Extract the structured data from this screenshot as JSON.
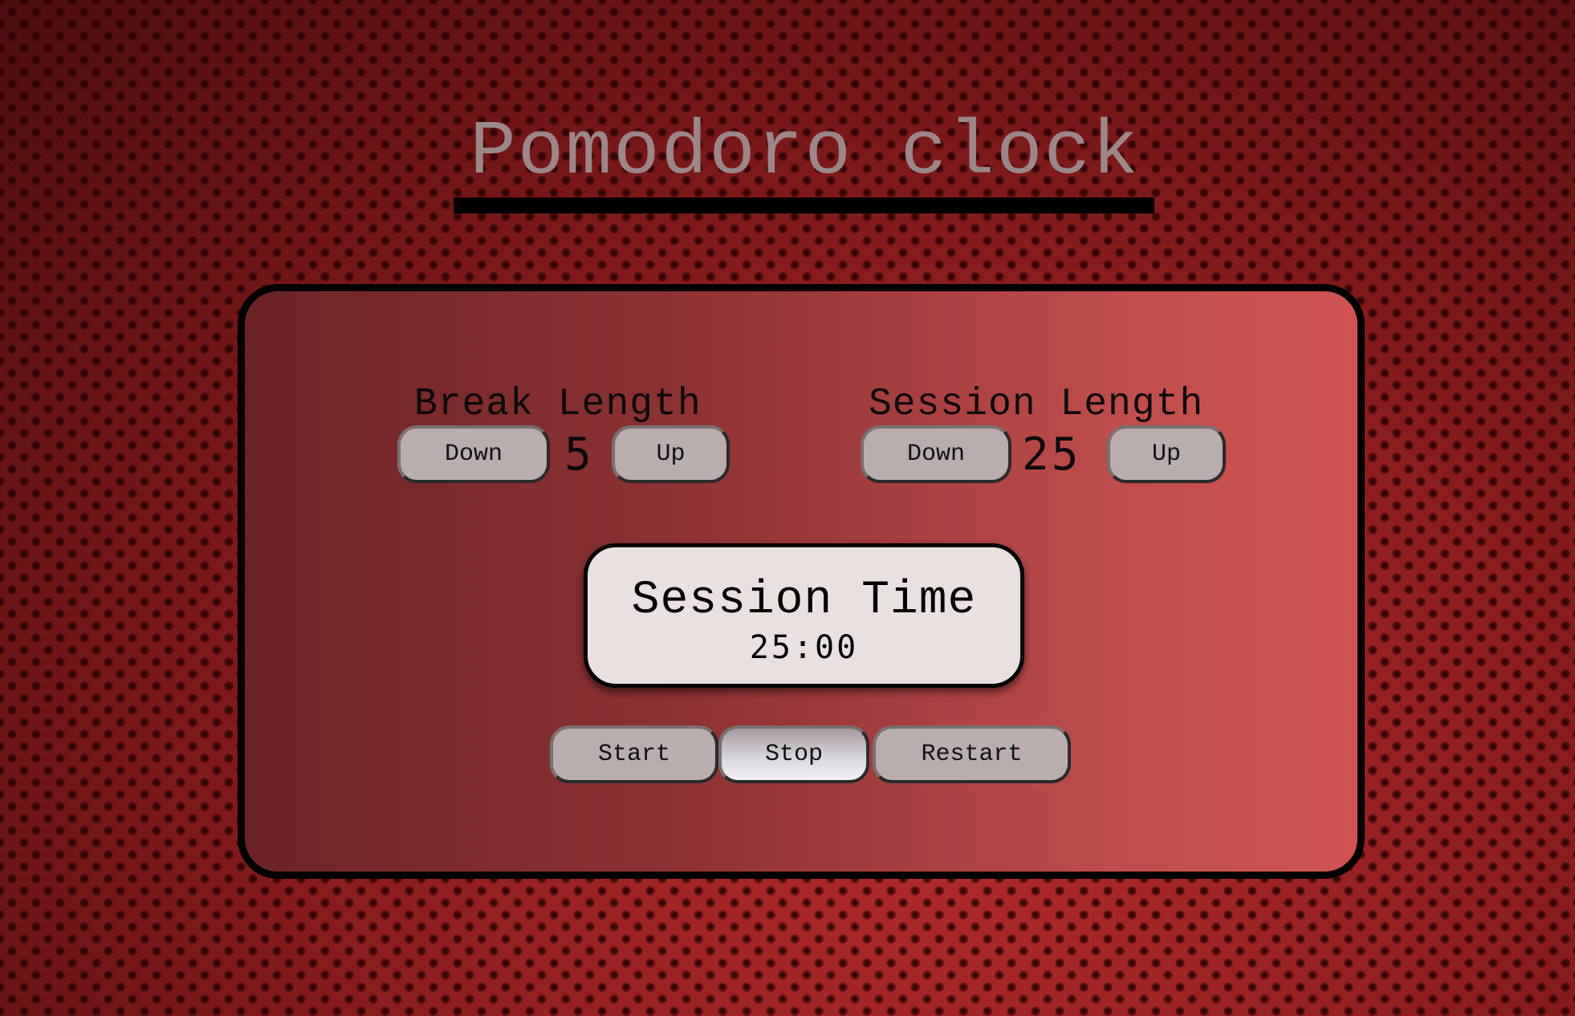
{
  "page": {
    "title": "Pomodoro clock"
  },
  "break": {
    "label": "Break Length",
    "down_label": "Down",
    "value": "5",
    "up_label": "Up"
  },
  "session": {
    "label": "Session Length",
    "down_label": "Down",
    "value": "25",
    "up_label": "Up"
  },
  "display": {
    "title": "Session Time",
    "time": "25:00"
  },
  "controls": {
    "start_label": "Start",
    "stop_label": "Stop",
    "restart_label": "Restart"
  },
  "colors": {
    "background": "#8e1c1c",
    "panel_gradient_start": "#6b2426",
    "panel_gradient_end": "#d0534f",
    "title_text": "#9a8888",
    "button": "#b9adad",
    "display_background": "#e8e1e0"
  }
}
